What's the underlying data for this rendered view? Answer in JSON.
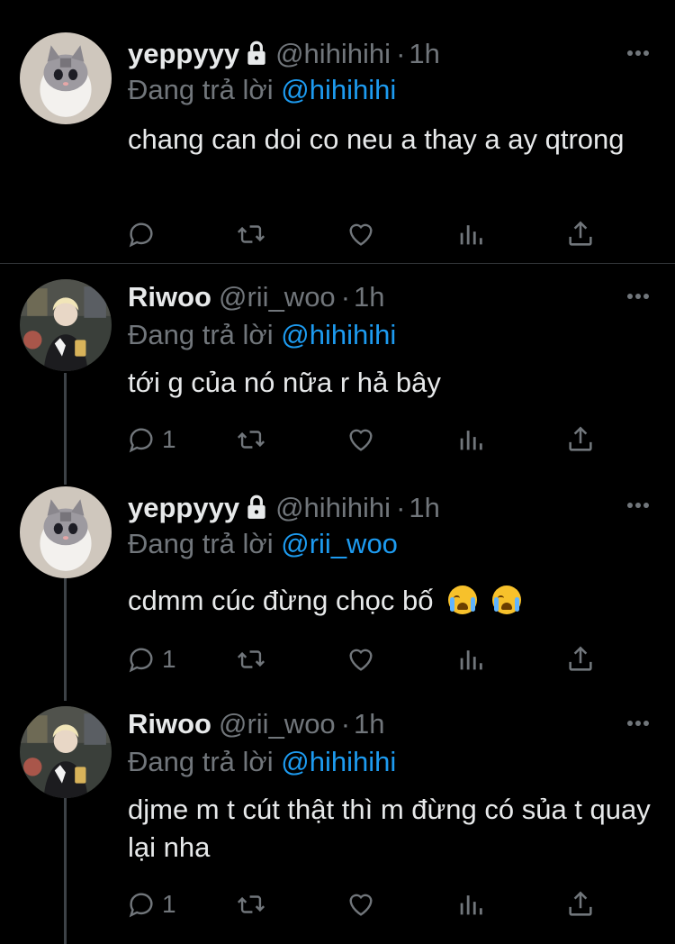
{
  "tweets": [
    {
      "name": "yeppyyy",
      "locked": true,
      "handle": "@hihihihi",
      "dot": "·",
      "time": "1h",
      "reply_prefix": "Đang trả lời",
      "reply_to": "@hihihihi",
      "text": "chang can doi co neu a thay a ay qtrong",
      "emoji_count": 0,
      "reply_count": "",
      "avatar": "cat-avatar"
    },
    {
      "name": "Riwoo",
      "locked": false,
      "handle": "@rii_woo",
      "dot": "·",
      "time": "1h",
      "reply_prefix": "Đang trả lời",
      "reply_to": "@hihihihi",
      "text": "tới g của nó nữa r hả bây",
      "emoji_count": 0,
      "reply_count": "1",
      "avatar": "person-avatar"
    },
    {
      "name": "yeppyyy",
      "locked": true,
      "handle": "@hihihihi",
      "dot": "·",
      "time": "1h",
      "reply_prefix": "Đang trả lời",
      "reply_to": "@rii_woo",
      "text": "cdmm cúc đừng chọc bố",
      "emoji_count": 2,
      "reply_count": "1",
      "avatar": "cat-avatar"
    },
    {
      "name": "Riwoo",
      "locked": false,
      "handle": "@rii_woo",
      "dot": "·",
      "time": "1h",
      "reply_prefix": "Đang trả lời",
      "reply_to": "@hihihihi",
      "text": "djme m t cút thật thì m đừng có sủa t quay lại nha",
      "emoji_count": 0,
      "reply_count": "1",
      "avatar": "person-avatar"
    }
  ],
  "colors": {
    "background": "#000000",
    "muted": "#71767b",
    "mention": "#1d9bf0",
    "text": "#e7e9ea"
  },
  "icons": [
    "lock-icon",
    "more-icon",
    "reply-icon",
    "retweet-icon",
    "like-icon",
    "views-icon",
    "share-icon",
    "loudly-crying-emoji"
  ]
}
